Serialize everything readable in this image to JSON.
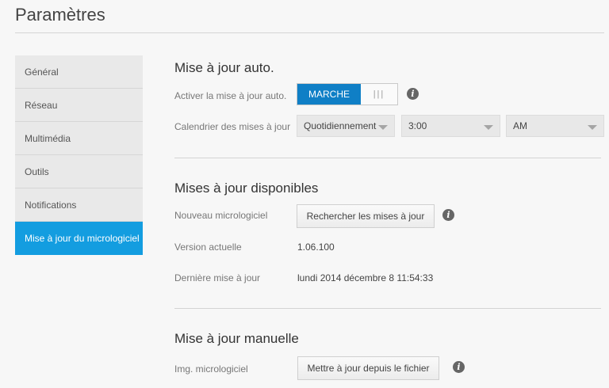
{
  "page": {
    "title": "Paramètres"
  },
  "sidebar": {
    "items": [
      {
        "label": "Général"
      },
      {
        "label": "Réseau"
      },
      {
        "label": "Multimédia"
      },
      {
        "label": "Outils"
      },
      {
        "label": "Notifications"
      },
      {
        "label": "Mise à jour du micrologiciel",
        "active": true
      }
    ]
  },
  "auto_update": {
    "title": "Mise à jour auto.",
    "enable_label": "Activer la mise à jour auto.",
    "toggle_on_label": "MARCHE",
    "toggle_off_label": "|||",
    "toggle_state": "on",
    "schedule_label": "Calendrier des mises à jour",
    "frequency_value": "Quotidiennement",
    "time_value": "3:00",
    "ampm_value": "AM"
  },
  "available_updates": {
    "title": "Mises à jour disponibles",
    "new_firmware_label": "Nouveau micrologiciel",
    "check_button_label": "Rechercher les mises à jour",
    "current_version_label": "Version actuelle",
    "current_version_value": "1.06.100",
    "last_update_label": "Dernière mise à jour",
    "last_update_value": "lundi 2014 décembre 8 11:54:33"
  },
  "manual_update": {
    "title": "Mise à jour manuelle",
    "image_label": "Img. micrologiciel",
    "upload_button_label": "Mettre à jour depuis le fichier"
  },
  "colors": {
    "accent": "#139de0",
    "toggle_on": "#0f7fc6",
    "background": "#f7f7f7"
  },
  "icons": {
    "info": "info-icon"
  }
}
